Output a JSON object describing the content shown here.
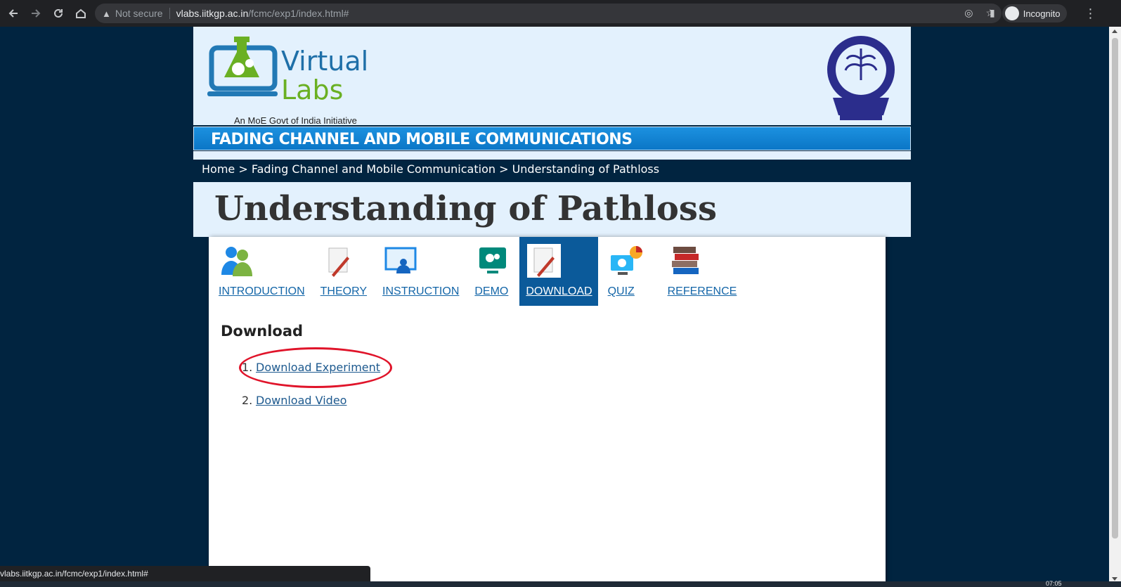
{
  "browser": {
    "not_secure_label": "Not secure",
    "url_host": "vlabs.iitkgp.ac.in",
    "url_path": "/fcmc/exp1/index.html#",
    "incognito_label": "Incognito",
    "status_url": "vlabs.iitkgp.ac.in/fcmc/exp1/index.html#",
    "clock": "07:05"
  },
  "header": {
    "logo_line1": "Virtual",
    "logo_line2": "Labs",
    "tagline": "An MoE Govt of India Initiative",
    "banner_title": "FADING CHANNEL AND MOBILE COMMUNICATIONS"
  },
  "breadcrumb": "Home > Fading Channel and Mobile Communication > Understanding of Pathloss",
  "page_title": "Understanding of Pathloss",
  "tabs": [
    {
      "label": "INTRODUCTION",
      "icon": "users-icon"
    },
    {
      "label": "THEORY",
      "icon": "document-pen-icon"
    },
    {
      "label": "INSTRUCTION",
      "icon": "presenter-icon"
    },
    {
      "label": "DEMO",
      "icon": "gears-monitor-icon"
    },
    {
      "label": "DOWNLOAD",
      "icon": "document-pen-icon",
      "active": true
    },
    {
      "label": "QUIZ",
      "icon": "monitor-chart-icon"
    },
    {
      "label": "REFERENCE",
      "icon": "books-icon"
    }
  ],
  "download": {
    "heading": "Download",
    "items": [
      {
        "num": "1.",
        "label": "Download Experiment"
      },
      {
        "num": "2.",
        "label": "Download Video"
      }
    ]
  },
  "colors": {
    "page_bg": "#012440",
    "header_bg": "#e3f1fd",
    "banner": "#1c91e0",
    "active_tab": "#0b5a9a",
    "highlight_circle": "#e0142a"
  }
}
